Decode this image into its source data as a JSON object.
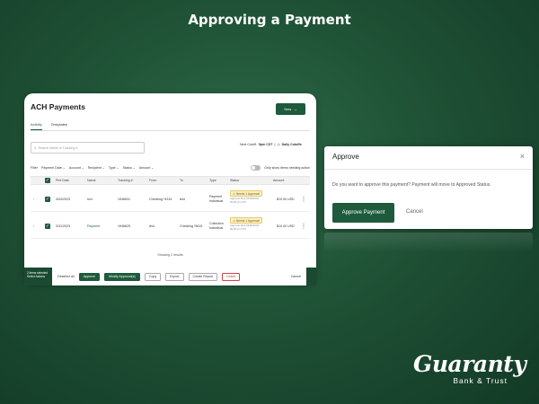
{
  "slide": {
    "title": "Approving a Payment"
  },
  "ach": {
    "title": "ACH Payments",
    "new_button": "New",
    "tabs": [
      "Activity",
      "Templates"
    ],
    "search_placeholder": "Search Name or Tracking #",
    "cutoff_label": "Next Cutoff:",
    "cutoff_time": "5pm CST",
    "daily_cutoffs": "Daily Cutoffs",
    "filters": [
      "Filter",
      "Payment Date",
      "Account",
      "Recipient",
      "Type",
      "Status",
      "Amount"
    ],
    "toggle_label": "Only show items needing action",
    "columns": [
      "Pmt Date",
      "Name",
      "Tracking #",
      "From",
      "To",
      "Type",
      "Status",
      "Amount"
    ],
    "rows": [
      {
        "date": "4/04/2023",
        "name": "test",
        "tracking": "1946631",
        "from": "Checking *4315",
        "to": "test",
        "type1": "Payment",
        "type2": "Individual",
        "status": "Needs 1 Approval",
        "status_sub1": "Approver Due 04/03/2023",
        "status_sub2": "05:00 pm CST",
        "amount": "$10.00 USD"
      },
      {
        "date": "3/31/2023",
        "name": "Payment",
        "tracking": "1946625",
        "from": "test",
        "to": "Checking *5615",
        "type1": "Collection",
        "type2": "Individual",
        "status": "Needs 1 Approval",
        "status_sub1": "Approver Due 03/30/2023",
        "status_sub2": "05:00 pm CST",
        "amount": "$10.00 USD"
      }
    ],
    "showing": "Showing 2 results"
  },
  "actionbar": {
    "selected": [
      "2 items selected",
      "Select Actions"
    ],
    "deselect": "Deselect all",
    "approve": "Approve",
    "modify": "Modify Approval(s)",
    "copy": "Copy",
    "export": "Export",
    "create_report": "Create Report",
    "delete": "Delete",
    "cancel": "Cancel"
  },
  "dialog": {
    "title": "Approve",
    "close": "×",
    "message": "Do you want to approve this payment? Payment will move to Approved Status.",
    "approve_button": "Approve Payment",
    "cancel_button": "Cancel"
  },
  "logo": {
    "main": "Guaranty",
    "sub": "Bank & Trust"
  },
  "icons": [
    "search-icon",
    "clock-icon",
    "chevron-down-icon",
    "check-icon",
    "warning-icon",
    "close-icon",
    "more-icon"
  ]
}
